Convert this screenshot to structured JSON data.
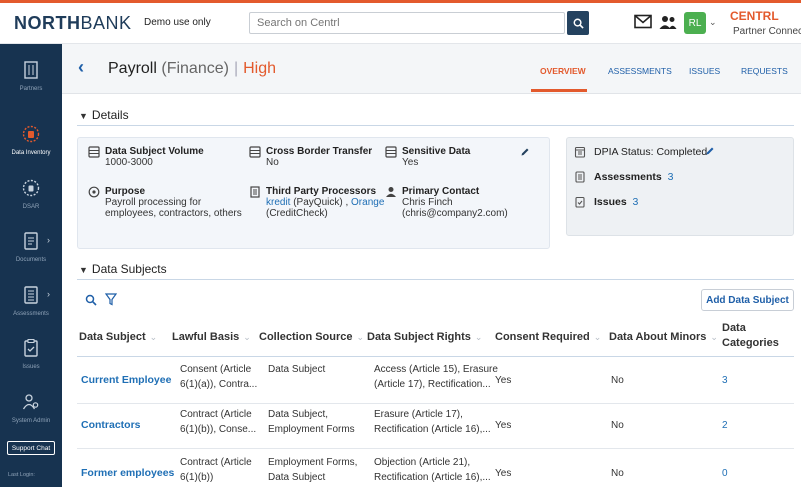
{
  "topbar": {
    "brand_prefix": "NORTH",
    "brand_suffix": "BANK",
    "demo_text": "Demo use only",
    "search_placeholder": "Search on Centrl",
    "avatar_initials": "RL",
    "company": "CENTRL",
    "portal": "Partner Connect ˅"
  },
  "sidebar": {
    "items": [
      {
        "label": "Partners",
        "icon": "building-icon"
      },
      {
        "label": "Data Inventory",
        "icon": "data-inventory-icon"
      },
      {
        "label": "DSAR",
        "icon": "dsar-icon"
      },
      {
        "label": "Documents",
        "icon": "document-icon"
      },
      {
        "label": "Assessments",
        "icon": "assessment-icon"
      },
      {
        "label": "Issues",
        "icon": "issues-icon"
      },
      {
        "label": "System Admin",
        "icon": "system-admin-icon"
      }
    ],
    "support_label": "Support Chat",
    "last_login": "Last Login:"
  },
  "header": {
    "title": "Payroll",
    "subtitle": "(Finance)",
    "separator": "|",
    "risk": "High",
    "tabs": [
      "OVERVIEW",
      "ASSESSMENTS",
      "ISSUES",
      "REQUESTS"
    ]
  },
  "details": {
    "title": "Details",
    "volume_label": "Data Subject Volume",
    "volume_value": "1000-3000",
    "cross_border_label": "Cross Border Transfer",
    "cross_border_value": "No",
    "sensitive_label": "Sensitive Data",
    "sensitive_value": "Yes",
    "purpose_label": "Purpose",
    "purpose_line1": "Payroll processing for",
    "purpose_line2": "employees, contractors, others",
    "third_party_label": "Third Party Processors",
    "processor1": "kredit",
    "processor1_suffix": " (PayQuick) , ",
    "processor2": "Orange",
    "processor2_suffix": "(CreditCheck)",
    "contact_label": "Primary Contact",
    "contact_name": "Chris Finch",
    "contact_email": "(chris@company2.com)"
  },
  "dpia": {
    "status_label": "DPIA Status:",
    "status_value": "Completed",
    "assessments_label": "Assessments",
    "assessments_count": "3",
    "issues_label": "Issues",
    "issues_count": "3"
  },
  "data_subjects": {
    "title": "Data Subjects",
    "add_button": "Add Data Subject",
    "columns": [
      "Data Subject",
      "Lawful Basis",
      "Collection Source",
      "Data Subject Rights",
      "Consent Required",
      "Data About Minors",
      "Data",
      "Categories"
    ],
    "rows": [
      {
        "name": "Current Employee",
        "basis1": "Consent (Article",
        "basis2": "6(1)(a)), Contra...",
        "source1": "Data Subject",
        "source2": "",
        "rights1": "Access (Article 15), Erasure",
        "rights2": "(Article 17), Rectification...",
        "consent": "Yes",
        "minors": "No",
        "categories": "3"
      },
      {
        "name": "Contractors",
        "basis1": "Contract (Article",
        "basis2": "6(1)(b)), Conse...",
        "source1": "Data Subject,",
        "source2": "Employment Forms",
        "rights1": "Erasure (Article 17),",
        "rights2": "Rectification (Article 16),...",
        "consent": "Yes",
        "minors": "No",
        "categories": "2"
      },
      {
        "name": "Former employees",
        "basis1": "Contract (Article",
        "basis2": "6(1)(b))",
        "source1": "Employment Forms,",
        "source2": "Data Subject",
        "rights1": "Objection (Article 21),",
        "rights2": "Rectification (Article 16),...",
        "consent": "Yes",
        "minors": "No",
        "categories": "0"
      }
    ]
  },
  "colors": {
    "accent": "#e35a2d",
    "sidebar": "#173350",
    "link": "#1f6fb5",
    "avatar": "#4caf50"
  }
}
